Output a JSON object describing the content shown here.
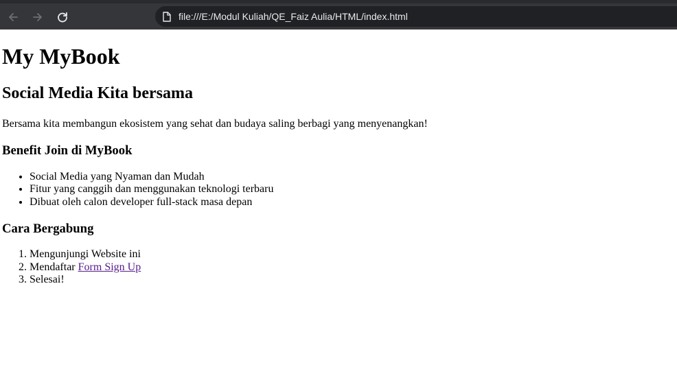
{
  "browser": {
    "url": "file:///E:/Modul Kuliah/QE_Faiz Aulia/HTML/index.html",
    "icons": [
      "back-arrow-icon",
      "forward-arrow-icon",
      "reload-icon",
      "file-icon"
    ],
    "colors": {
      "toolbar": "#35363a",
      "urlbar": "#202124",
      "url_text": "#e8eaed"
    }
  },
  "page": {
    "title": "My MyBook",
    "subtitle": "Social Media Kita bersama",
    "description": "Bersama kita membangun ekosistem yang sehat dan budaya saling berbagi yang menyenangkan!",
    "benefits": {
      "heading": "Benefit Join di MyBook",
      "items": [
        "Social Media yang Nyaman dan Mudah",
        "Fitur yang canggih dan menggunakan teknologi terbaru",
        "Dibuat oleh calon developer full-stack masa depan"
      ]
    },
    "join": {
      "heading": "Cara Bergabung",
      "step1": "Mengunjungi Website ini",
      "step2_prefix": "Mendaftar ",
      "step2_link": "Form Sign Up",
      "step3": "Selesai!"
    },
    "link_color": "#551a8b"
  }
}
